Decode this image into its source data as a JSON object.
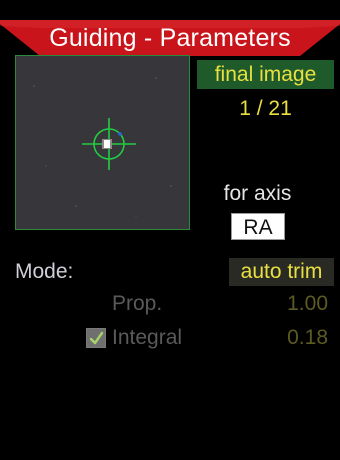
{
  "title": "Guiding - Parameters",
  "preview": {
    "label": "final image",
    "frame_counter": "1 / 21"
  },
  "axis": {
    "label": "for axis",
    "value": "RA"
  },
  "mode": {
    "label": "Mode:",
    "value": "auto trim"
  },
  "params": [
    {
      "label": "Prop.",
      "value": "1.00",
      "checked": null
    },
    {
      "label": "Integral",
      "value": "0.18",
      "checked": true
    }
  ],
  "colors": {
    "title_bar": "#c8141a",
    "accent_yellow": "#e8e040",
    "green_label_bg": "#1f5a2a",
    "crosshair": "#22cc44"
  }
}
